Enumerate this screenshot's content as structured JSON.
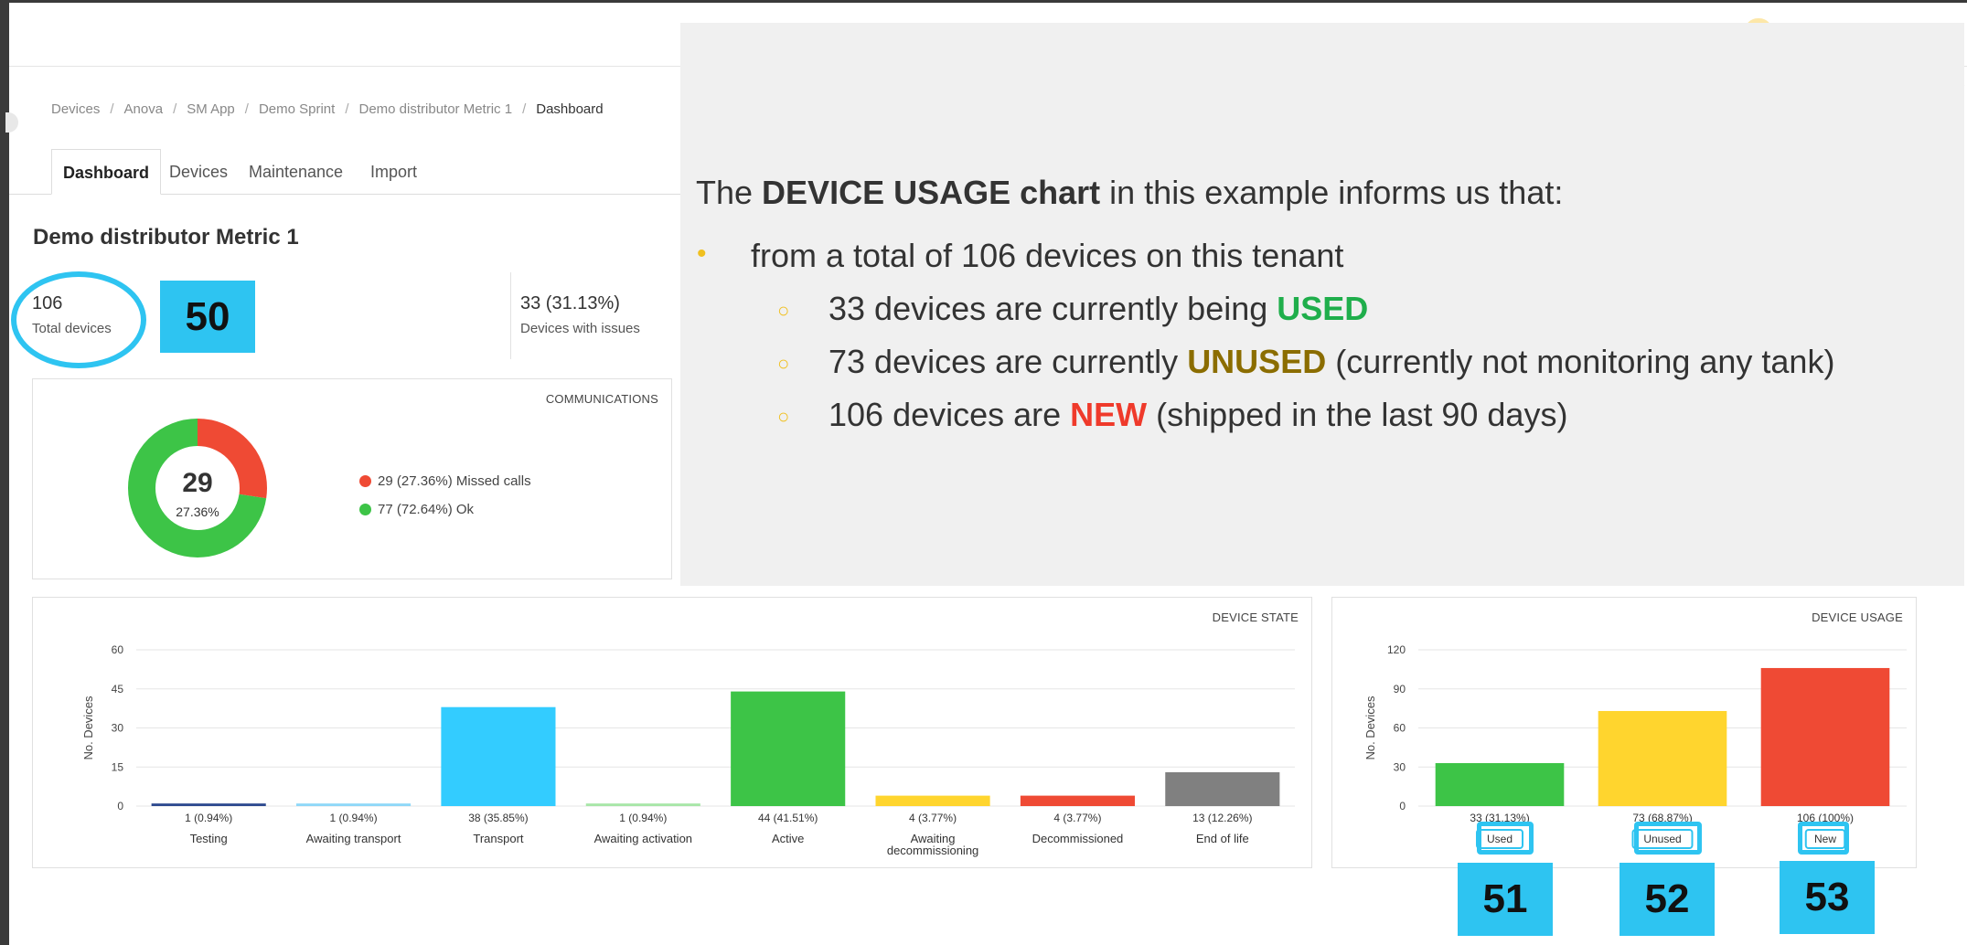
{
  "breadcrumb": [
    "Devices",
    "Anova",
    "SM App",
    "Demo Sprint",
    "Demo distributor Metric 1",
    "Dashboard"
  ],
  "tabs": [
    "Dashboard",
    "Devices",
    "Maintenance",
    "Import"
  ],
  "page_title": "Demo distributor Metric 1",
  "kpis": {
    "total_value": "106",
    "total_label": "Total devices",
    "issues_value": "33 (31.13%)",
    "issues_label": "Devices with issues"
  },
  "callouts": {
    "c50": "50",
    "c51": "51",
    "c52": "52",
    "c53": "53"
  },
  "communications": {
    "title": "COMMUNICATIONS",
    "center_value": "29",
    "center_pct": "27.36%",
    "legend": [
      {
        "label": "29 (27.36%) Missed calls",
        "color": "#ef4a34"
      },
      {
        "label": "77 (72.64%) Ok",
        "color": "#3dc447"
      }
    ]
  },
  "overlay": {
    "heading_pre": "The ",
    "heading_bold": "DEVICE USAGE chart",
    "heading_post": " in this example informs us that:",
    "bullet": "from a total of 106 devices on this tenant",
    "sub1_pre": "33 devices are currently being ",
    "sub1_kw": "USED",
    "sub2_pre": "73 devices are currently ",
    "sub2_kw": "UNUSED",
    "sub2_post": " (currently not monitoring any tank)",
    "sub3_pre": "106 devices are ",
    "sub3_kw": "NEW",
    "sub3_post": " (shipped in the last 90 days)",
    "bullet_glyph": "•",
    "sub_glyph": "○"
  },
  "chart_data": [
    {
      "type": "bar",
      "title": "DEVICE STATE",
      "ylabel": "No. Devices",
      "ylim": [
        0,
        60
      ],
      "yticks": [
        0,
        15,
        30,
        45,
        60
      ],
      "grid": true,
      "categories": [
        "Testing",
        "Awaiting transport",
        "Transport",
        "Awaiting activation",
        "Active",
        "Awaiting decommissioning",
        "Decommissioned",
        "End of life"
      ],
      "values": [
        1,
        1,
        38,
        1,
        44,
        4,
        4,
        13
      ],
      "data_labels": [
        "1 (0.94%)",
        "1 (0.94%)",
        "38 (35.85%)",
        "1 (0.94%)",
        "44 (41.51%)",
        "4 (3.77%)",
        "4 (3.77%)",
        "13 (12.26%)"
      ],
      "colors": [
        "#2e4a8f",
        "#8fd8f8",
        "#33ccff",
        "#a8e6a8",
        "#3dc447",
        "#ffd52e",
        "#ef4a34",
        "#808080"
      ]
    },
    {
      "type": "bar",
      "title": "DEVICE USAGE",
      "ylabel": "No. Devices",
      "ylim": [
        0,
        120
      ],
      "yticks": [
        0,
        30,
        60,
        90,
        120
      ],
      "grid": true,
      "categories": [
        "Used",
        "Unused",
        "New"
      ],
      "values": [
        33,
        73,
        106
      ],
      "data_labels": [
        "33 (31.13%)",
        "73 (68.87%)",
        "106 (100%)"
      ],
      "colors": [
        "#3dc447",
        "#ffd52e",
        "#ef4a34"
      ]
    }
  ]
}
